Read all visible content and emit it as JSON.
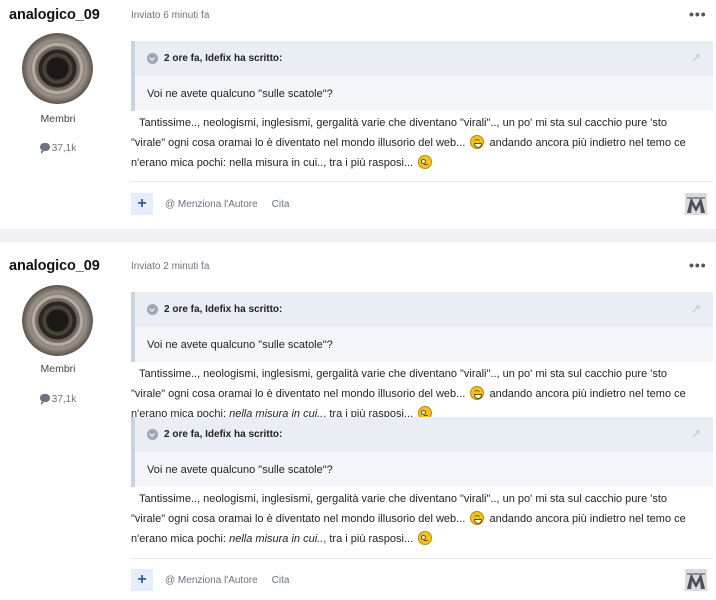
{
  "posts": [
    {
      "author": "analogico_09",
      "group": "Membri",
      "post_count": "37,1k",
      "date": "Inviato 6 minuti fa",
      "menu": "•••",
      "quotes": [
        {
          "header": "2 ore fa, Idefix ha scritto:",
          "text": "Voi ne avete qualcuno \"sulle scatole\"?",
          "reply": {
            "line1": "Tantissime.., neologismi, inglesismi, gergalità varie che diventano \"virali\".., un po' mi sta sul cacchio pure 'sto",
            "line2a": "\"virale\" ogni cosa oramai lo è diventato nel mondo illusorio del web...",
            "line2b": "andando ancora più indietro nel temo ce",
            "line3a": "n'erano mica pochi: nella misura in cui.., tra i più rasposi...",
            "line3_italic": "",
            "line3b": ""
          }
        }
      ],
      "footer": {
        "plus": "+",
        "mention": "@ Menziona l'Autore",
        "quote": "Cita"
      }
    },
    {
      "author": "analogico_09",
      "group": "Membri",
      "post_count": "37,1k",
      "date": "Inviato 2 minuti fa",
      "menu": "•••",
      "quotes": [
        {
          "header": "2 ore fa, Idefix ha scritto:",
          "text": "Voi ne avete qualcuno \"sulle scatole\"?",
          "reply": {
            "line1": "Tantissime.., neologismi, inglesismi, gergalità varie che diventano \"virali\".., un po' mi sta sul cacchio pure 'sto",
            "line2a": "\"virale\" ogni cosa oramai lo è diventato nel mondo illusorio del web...",
            "line2b": "andando ancora più indietro nel temo ce",
            "line3a": "n'erano mica pochi:",
            "line3_italic": "nella misura in cui..",
            "line3b": ", tra i più rasposi..."
          }
        },
        {
          "header": "2 ore fa, Idefix ha scritto:",
          "text": "Voi ne avete qualcuno \"sulle scatole\"?",
          "reply": {
            "line1": "Tantissime.., neologismi, inglesismi, gergalità varie che diventano \"virali\".., un po' mi sta sul cacchio pure 'sto",
            "line2a": "\"virale\" ogni cosa oramai lo è diventato nel mondo illusorio del web...",
            "line2b": "andando ancora più indietro nel temo ce",
            "line3a": "n'erano mica pochi:",
            "line3_italic": "nella misura in cui..",
            "line3b": ", tra i più rasposi..."
          }
        }
      ],
      "footer": {
        "plus": "+",
        "mention": "@ Menziona l'Autore",
        "quote": "Cita"
      }
    }
  ],
  "icons": {
    "quote": "quote-marker-icon",
    "share": "share-arrow-icon",
    "posts": "comment-bubble-icon",
    "emoji_grin": "grin-emoji-icon",
    "emoji_rolleyes": "rolleyes-emoji-icon",
    "logo": "site-logo-icon"
  }
}
